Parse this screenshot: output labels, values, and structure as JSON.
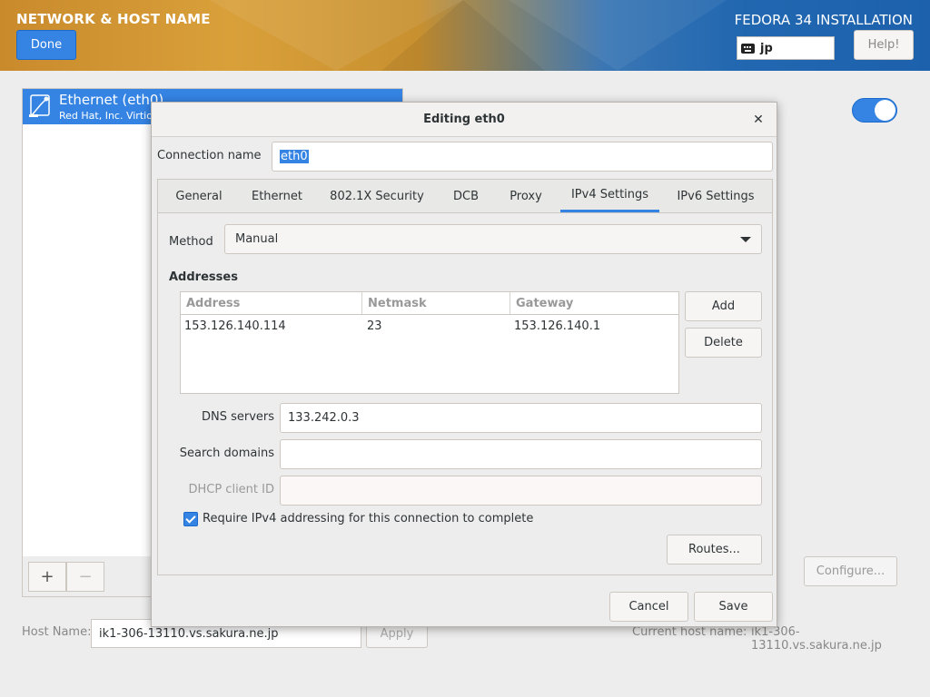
{
  "header": {
    "spoke_title": "NETWORK & HOST NAME",
    "done_label": "Done",
    "product_title": "FEDORA 34 INSTALLATION",
    "keyboard_layout": "jp",
    "help_label": "Help!"
  },
  "device_list": {
    "items": [
      {
        "name": "Ethernet (eth0)",
        "subtitle": "Red Hat, Inc. Virtio ne",
        "icon": "ethernet-icon"
      }
    ],
    "add_label": "+",
    "remove_label": "−"
  },
  "device_toggle": {
    "on": true
  },
  "configure_label": "Configure...",
  "hostname": {
    "label": "Host Name:",
    "value": "ik1-306-13110.vs.sakura.ne.jp",
    "apply_label": "Apply",
    "current_label": "Current host name:",
    "current_value": "ik1-306-13110.vs.sakura.ne.jp"
  },
  "dialog": {
    "title": "Editing eth0",
    "close_icon": "close-icon",
    "connection_name_label": "Connection name",
    "connection_name_value": "eth0",
    "tabs": [
      {
        "label": "General"
      },
      {
        "label": "Ethernet"
      },
      {
        "label": "802.1X Security"
      },
      {
        "label": "DCB"
      },
      {
        "label": "Proxy"
      },
      {
        "label": "IPv4 Settings"
      },
      {
        "label": "IPv6 Settings"
      }
    ],
    "active_tab": "IPv4 Settings",
    "ipv4": {
      "method_label": "Method",
      "method_value": "Manual",
      "addresses_heading": "Addresses",
      "columns": [
        "Address",
        "Netmask",
        "Gateway"
      ],
      "rows": [
        {
          "address": "153.126.140.114",
          "netmask": "23",
          "gateway": "153.126.140.1"
        }
      ],
      "add_label": "Add",
      "delete_label": "Delete",
      "dns_label": "DNS servers",
      "dns_value": "133.242.0.3",
      "search_label": "Search domains",
      "search_value": "",
      "dhcp_label": "DHCP client ID",
      "dhcp_value": "",
      "require_label": "Require IPv4 addressing for this connection to complete",
      "require_checked": true,
      "routes_label": "Routes..."
    },
    "cancel_label": "Cancel",
    "save_label": "Save"
  },
  "colors": {
    "accent": "#3584e4",
    "header_left": "#d9a03a",
    "header_right": "#1d61ad"
  }
}
